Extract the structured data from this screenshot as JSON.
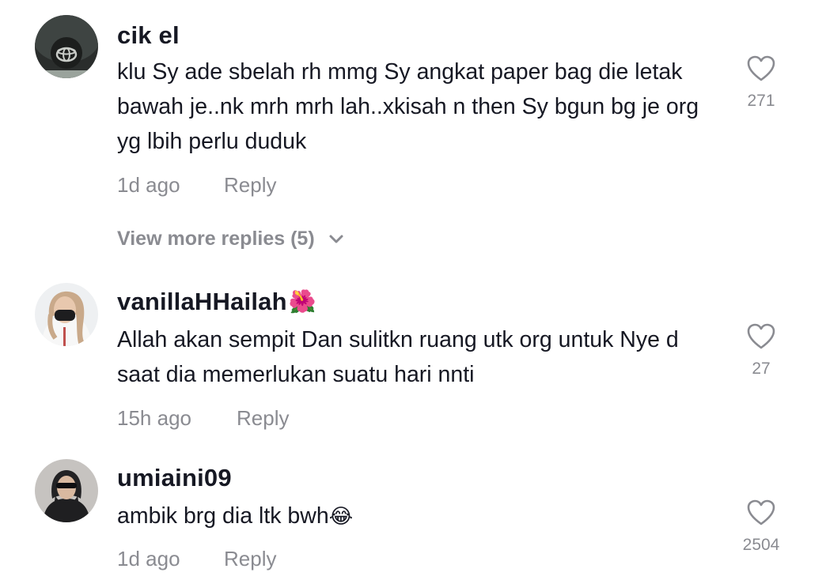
{
  "comments": [
    {
      "username": "cik el",
      "username_emoji": "",
      "text": "klu Sy ade sbelah rh mmg Sy angkat paper bag die letak bawah je..nk mrh mrh lah..xkisah n then Sy bgun bg je org yg lbih perlu duduk",
      "text_emoji": "",
      "time": "1d ago",
      "reply_label": "Reply",
      "likes": "271",
      "avatar_icon": "steering-wheel-avatar"
    },
    {
      "username": "vanillaHHailah",
      "username_emoji": "🌺",
      "text": "Allah akan sempit Dan sulitkn ruang utk org untuk Nye d saat dia memerlukan suatu hari nnti",
      "text_emoji": "",
      "time": "15h ago",
      "reply_label": "Reply",
      "likes": "27",
      "avatar_icon": "masked-person-avatar"
    },
    {
      "username": "umiaini09",
      "username_emoji": "",
      "text": "ambik brg dia ltk bwh",
      "text_emoji": "😂",
      "time": "1d ago",
      "reply_label": "Reply",
      "likes": "2504",
      "avatar_icon": "person-sunglasses-avatar"
    }
  ],
  "view_more": {
    "label": "View more replies (5)",
    "icon": "chevron-down-icon"
  },
  "colors": {
    "text": "#161823",
    "secondary": "#8a8b91",
    "background": "#ffffff"
  }
}
